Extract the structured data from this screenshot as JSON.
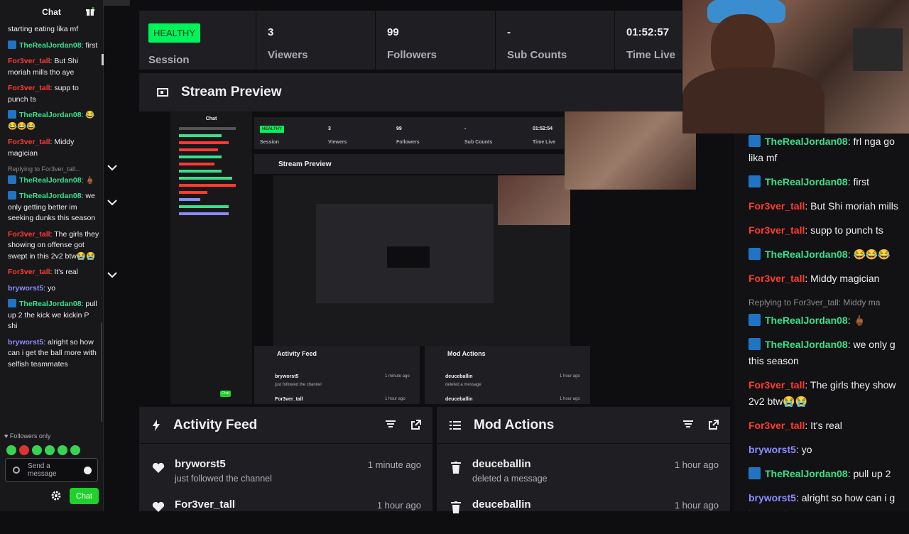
{
  "chat": {
    "title": "Chat",
    "messages": [
      {
        "user": "",
        "text": "starting eating lika mf",
        "color": "plain"
      },
      {
        "user": "TheRealJordan08",
        "text": "first",
        "color": "green",
        "badge": true
      },
      {
        "user": "For3ver_tall",
        "text": "But Shi moriah mills tho aye",
        "color": "red"
      },
      {
        "user": "For3ver_tall",
        "text": "supp to punch ts",
        "color": "red"
      },
      {
        "user": "TheRealJordan08",
        "text": "😂😂😂😂",
        "color": "green",
        "badge": true
      },
      {
        "user": "For3ver_tall",
        "text": "Middy magician",
        "color": "red"
      },
      {
        "reply": "Replying to For3ver_tall...",
        "user": "TheRealJordan08",
        "text": "🖕🏾",
        "color": "green",
        "badge": true
      },
      {
        "user": "TheRealJordan08",
        "text": "we only getting better im seeking dunks this season",
        "color": "green",
        "badge": true
      },
      {
        "user": "For3ver_tall",
        "text": "The girls they showing on offense got swept in this 2v2 btw😭😭",
        "color": "red"
      },
      {
        "user": "For3ver_tall",
        "text": "It's real",
        "color": "red"
      },
      {
        "user": "bryworst5",
        "text": "yo",
        "color": "blue"
      },
      {
        "user": "TheRealJordan08",
        "text": "pull up 2 the kick we kickin P shi",
        "color": "green",
        "badge": true
      },
      {
        "user": "bryworst5",
        "text": "alright so how can i get the ball more with selfish teammates",
        "color": "blue"
      }
    ],
    "followers_only": "Followers only",
    "input_placeholder": "Send a message",
    "send_label": "Chat"
  },
  "stats": {
    "health": "HEALTHY",
    "health_label": "Session",
    "items": [
      {
        "value": "3",
        "label": "Viewers"
      },
      {
        "value": "99",
        "label": "Followers"
      },
      {
        "value": "-",
        "label": "Sub Counts"
      },
      {
        "value": "01:52:57",
        "label": "Time Live"
      }
    ]
  },
  "preview": {
    "title": "Stream Preview"
  },
  "nested": {
    "health": "HEALTHY",
    "session": "Session",
    "stats": [
      {
        "value": "3",
        "label": "Viewers"
      },
      {
        "value": "99",
        "label": "Followers"
      },
      {
        "value": "-",
        "label": "Sub Counts"
      },
      {
        "value": "01:52:54",
        "label": "Time Live"
      }
    ],
    "title": "Stream Preview",
    "activity": "Activity Feed",
    "mod": "Mod Actions",
    "a1_name": "bryworst5",
    "a1_sub": "just followed the channel",
    "a1_time": "1 minute ago",
    "a2_name": "For3ver_tall",
    "a2_time": "1 hour ago",
    "m1_name": "deuceballin",
    "m1_sub": "deleted a message",
    "m1_time": "1 hour ago",
    "m2_name": "deuceballin",
    "m2_time": "1 hour ago",
    "chat_title": "Chat",
    "send": "Chat"
  },
  "activity": {
    "title": "Activity Feed",
    "rows": [
      {
        "name": "bryworst5",
        "sub": "just followed the channel",
        "time": "1 minute ago"
      },
      {
        "name": "For3ver_tall",
        "sub": "",
        "time": "1 hour ago"
      }
    ]
  },
  "mod": {
    "title": "Mod Actions",
    "rows": [
      {
        "name": "deuceballin",
        "sub": "deleted a message",
        "time": "1 hour ago"
      },
      {
        "name": "deuceballin",
        "sub": "",
        "time": "1 hour ago"
      }
    ]
  },
  "overlay": {
    "messages": [
      {
        "user": "TheRealJordan08",
        "text": "frl nga go lika mf",
        "color": "green",
        "badge": true
      },
      {
        "user": "TheRealJordan08",
        "text": "first",
        "color": "green",
        "badge": true
      },
      {
        "user": "For3ver_tall",
        "text": "But Shi moriah mills",
        "color": "red"
      },
      {
        "user": "For3ver_tall",
        "text": "supp to punch ts",
        "color": "red"
      },
      {
        "user": "TheRealJordan08",
        "text": "😂😂😂",
        "color": "green",
        "badge": true
      },
      {
        "user": "For3ver_tall",
        "text": "Middy magician",
        "color": "red"
      },
      {
        "reply": "Replying to For3ver_tall: Middy ma",
        "user": "TheRealJordan08",
        "text": "🖕🏾",
        "color": "green",
        "badge": true
      },
      {
        "user": "TheRealJordan08",
        "text": "we only g this season",
        "color": "green",
        "badge": true
      },
      {
        "user": "For3ver_tall",
        "text": "The girls they show 2v2 btw😭😭",
        "color": "red"
      },
      {
        "user": "For3ver_tall",
        "text": "It's real",
        "color": "red"
      },
      {
        "user": "bryworst5",
        "text": "yo",
        "color": "blue"
      },
      {
        "user": "TheRealJordan08",
        "text": "pull up 2",
        "color": "green",
        "badge": true
      },
      {
        "user": "bryworst5",
        "text": "alright so how can i g teammates",
        "color": "blue"
      }
    ]
  },
  "colors": {
    "accent": "#00f35b",
    "panel": "#1f1f23",
    "bg": "#0e0e10",
    "red_user": "#ff3b30",
    "green_user": "#38e08a",
    "blue_user": "#8b8bff"
  }
}
